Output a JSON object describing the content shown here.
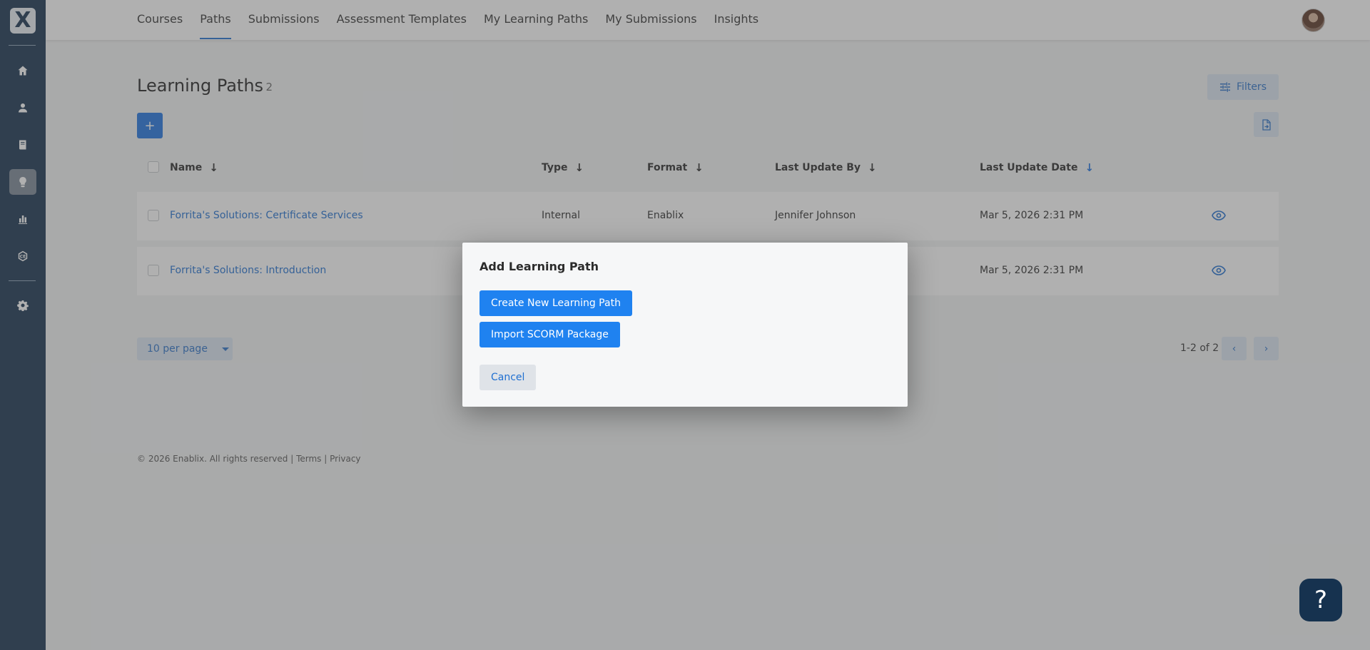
{
  "sidebar": {
    "logo_letter": "X",
    "items": [
      {
        "name": "home-icon"
      },
      {
        "name": "user-icon"
      },
      {
        "name": "book-icon"
      },
      {
        "name": "lightbulb-icon",
        "active": true
      },
      {
        "name": "bar-chart-icon"
      },
      {
        "name": "certificate-icon"
      },
      {
        "name": "gear-icon"
      }
    ]
  },
  "nav": {
    "links": [
      {
        "label": "Courses"
      },
      {
        "label": "Paths",
        "active": true
      },
      {
        "label": "Submissions"
      },
      {
        "label": "Assessment Templates"
      },
      {
        "label": "My Learning Paths"
      },
      {
        "label": "My Submissions"
      },
      {
        "label": "Insights"
      }
    ]
  },
  "page": {
    "title": "Learning Paths",
    "count": "· 2",
    "filters_label": "Filters",
    "add_label": "+"
  },
  "table": {
    "columns": [
      {
        "label": "Name",
        "arrow": "↓"
      },
      {
        "label": "Type",
        "arrow": "↓"
      },
      {
        "label": "Format",
        "arrow": "↓"
      },
      {
        "label": "Last Update By",
        "arrow": "↓"
      },
      {
        "label": "Last Update Date",
        "arrow": "↓"
      }
    ],
    "rows": [
      {
        "name": "Forrita's Solutions: Certificate Services",
        "type": "Internal",
        "format": "Enablix",
        "updated_by": "Jennifer Johnson",
        "updated_date": "Mar 5, 2026 2:31 PM"
      },
      {
        "name": "Forrita's Solutions: Introduction",
        "type": "",
        "format": "",
        "updated_by": "",
        "updated_date": "Mar 5, 2026 2:31 PM"
      }
    ]
  },
  "pagination": {
    "per_page": "10 per page",
    "range": "1-2 of 2",
    "prev": "‹",
    "next": "›"
  },
  "footer": {
    "text": "© 2026 Enablix. All rights reserved | Terms | Privacy"
  },
  "modal": {
    "title": "Add Learning Path",
    "create_label": "Create New Learning Path",
    "import_label": "Import SCORM Package",
    "cancel_label": "Cancel"
  },
  "help": {
    "label": "?"
  },
  "colors": {
    "sidebar": "#16324f",
    "accent": "#1f74e0",
    "modal_button": "#1f82f0"
  }
}
